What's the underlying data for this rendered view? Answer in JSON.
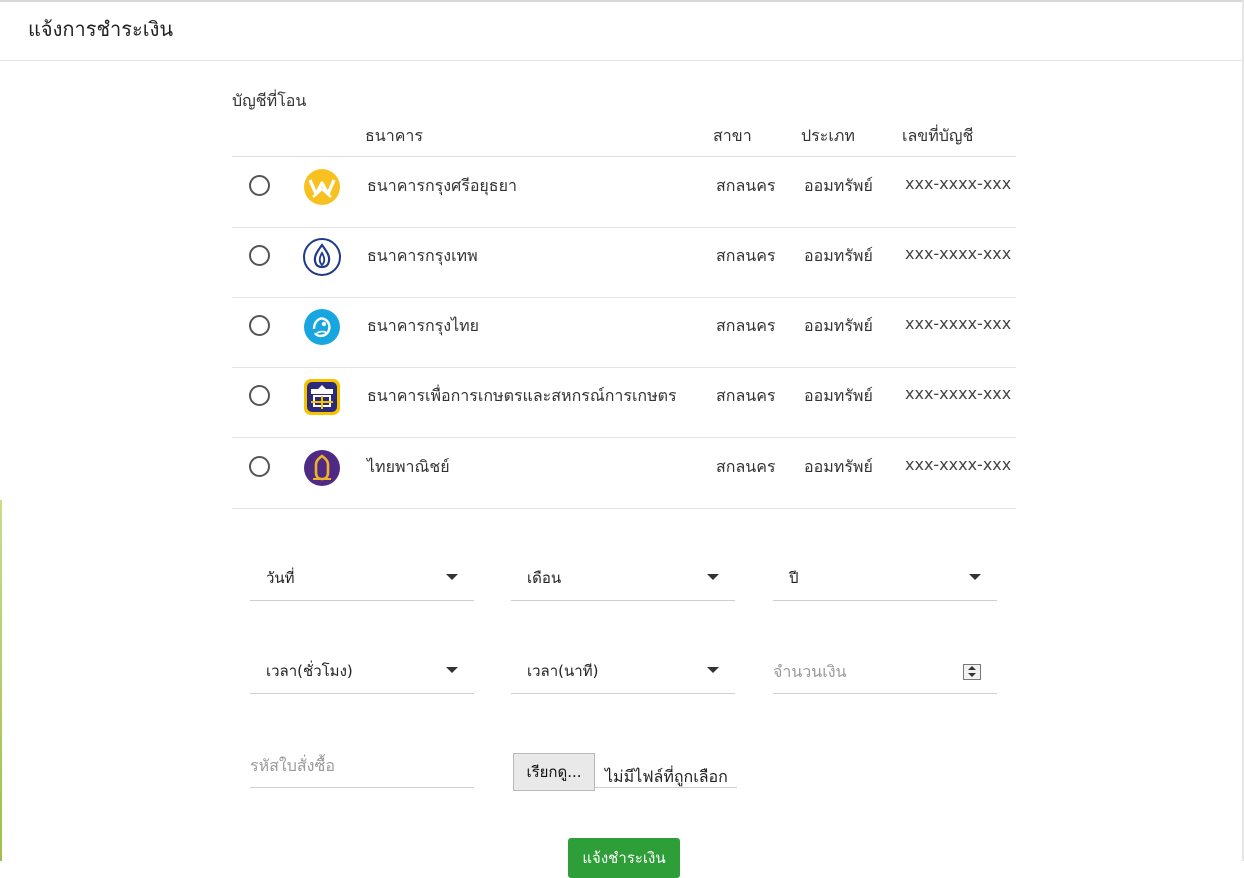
{
  "header": {
    "title": "แจ้งการชำระเงิน"
  },
  "accounts": {
    "section_label": "บัญชีที่โอน",
    "columns": {
      "bank": "ธนาคาร",
      "branch": "สาขา",
      "type": "ประเภท",
      "account_no": "เลขที่บัญชี"
    },
    "rows": [
      {
        "bank": "ธนาคารกรุงศรีอยุธยา",
        "branch": "สกลนคร",
        "type": "ออมทรัพย์",
        "account_no": "xxx-xxxx-xxx",
        "logo": "krungsri-logo",
        "color": "#f7c221"
      },
      {
        "bank": "ธนาคารกรุงเทพ",
        "branch": "สกลนคร",
        "type": "ออมทรัพย์",
        "account_no": "xxx-xxxx-xxx",
        "logo": "bangkok-bank-logo",
        "color": "#1e3a8a"
      },
      {
        "bank": "ธนาคารกรุงไทย",
        "branch": "สกลนคร",
        "type": "ออมทรัพย์",
        "account_no": "xxx-xxxx-xxx",
        "logo": "krungthai-logo",
        "color": "#18a6e0"
      },
      {
        "bank": "ธนาคารเพื่อการเกษตรและสหกรณ์การเกษตร",
        "branch": "สกลนคร",
        "type": "ออมทรัพย์",
        "account_no": "xxx-xxxx-xxx",
        "logo": "baac-logo",
        "color": "#2d2a7a"
      },
      {
        "bank": "ไทยพาณิชย์",
        "branch": "สกลนคร",
        "type": "ออมทรัพย์",
        "account_no": "xxx-xxxx-xxx",
        "logo": "scb-logo",
        "color": "#4e2a84"
      }
    ]
  },
  "form": {
    "day_label": "วันที่",
    "month_label": "เดือน",
    "year_label": "ปี",
    "hour_label": "เวลา(ชั่วโมง)",
    "minute_label": "เวลา(นาที)",
    "amount_placeholder": "จำนวนเงิน",
    "order_placeholder": "รหัสใบสั่งซื้อ",
    "file_button_label": "เรียกดู...",
    "file_status": "ไม่มีไฟล์ที่ถูกเลือก",
    "submit_label": "แจ้งชำระเงิน"
  },
  "colors": {
    "submit": "#2e9e38"
  }
}
